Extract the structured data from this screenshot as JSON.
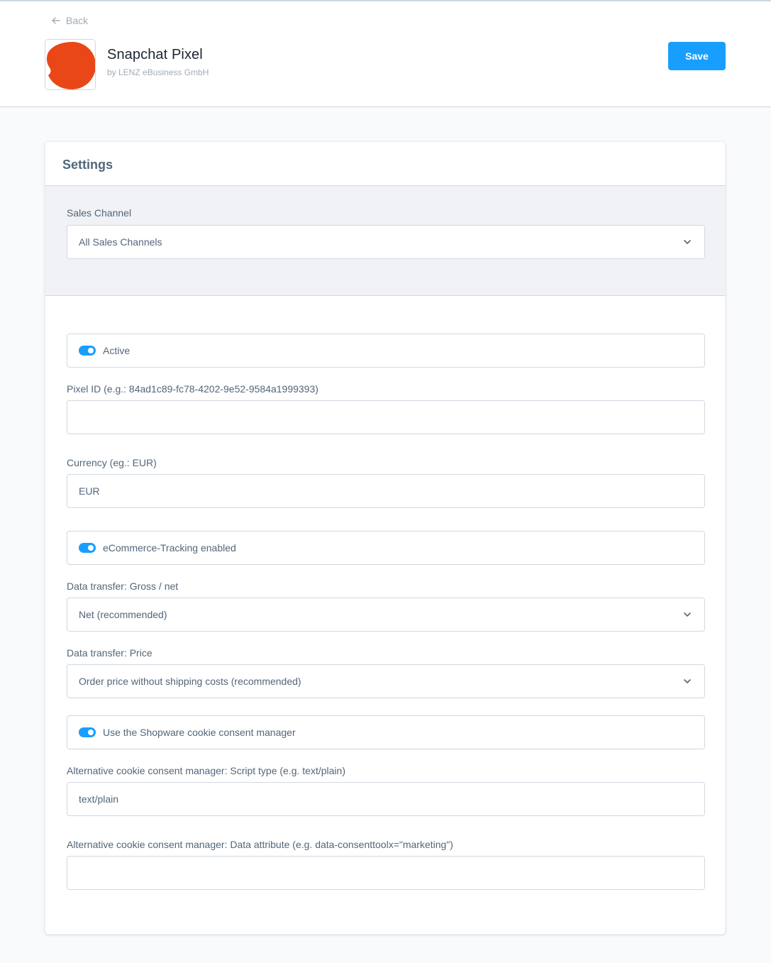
{
  "header": {
    "back_label": "Back",
    "app_title": "Snapchat Pixel",
    "app_vendor": "by LENZ eBusiness GmbH",
    "save_label": "Save",
    "logo_color": "#e94717"
  },
  "settings": {
    "title": "Settings",
    "sales_channel": {
      "label": "Sales Channel",
      "value": "All Sales Channels"
    },
    "active": {
      "label": "Active",
      "checked": true
    },
    "pixel_id": {
      "label": "Pixel ID (e.g.: 84ad1c89-fc78-4202-9e52-9584a1999393)",
      "value": ""
    },
    "currency": {
      "label": "Currency (eg.: EUR)",
      "value": "EUR"
    },
    "ecommerce_tracking": {
      "label": "eCommerce-Tracking enabled",
      "checked": true
    },
    "gross_net": {
      "label": "Data transfer: Gross / net",
      "value": "Net (recommended)"
    },
    "price": {
      "label": "Data transfer: Price",
      "value": "Order price without shipping costs (recommended)"
    },
    "cookie_consent": {
      "label": "Use the Shopware cookie consent manager",
      "checked": true
    },
    "script_type": {
      "label": "Alternative cookie consent manager: Script type (e.g. text/plain)",
      "value": "text/plain"
    },
    "data_attribute": {
      "label": "Alternative cookie consent manager: Data attribute (e.g. data-consenttoolx=\"marketing\")",
      "value": ""
    }
  },
  "colors": {
    "accent": "#189eff",
    "border": "#d1d9e0",
    "text": "#52667a"
  }
}
